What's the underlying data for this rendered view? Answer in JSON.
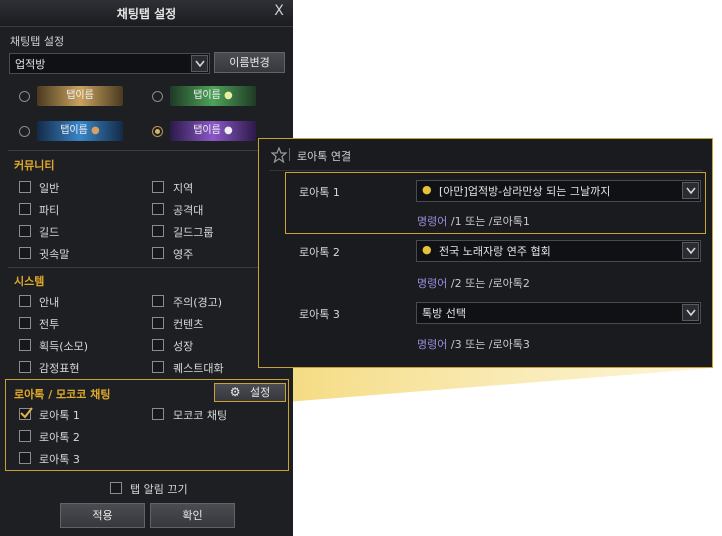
{
  "dialog": {
    "title": "채팅탭 설정",
    "close_label": "X",
    "section_label": "채팅탭 설정",
    "tab_select_value": "업적방",
    "rename_button": "이름변경",
    "tab_styles": [
      {
        "label": "탭이름",
        "selected": false
      },
      {
        "label": "탭이름",
        "selected": false
      },
      {
        "label": "탭이름",
        "selected": false
      },
      {
        "label": "탭이름",
        "selected": true
      }
    ],
    "community": {
      "title": "커뮤니티",
      "items": [
        {
          "label": "일반",
          "checked": false
        },
        {
          "label": "지역",
          "checked": false
        },
        {
          "label": "파티",
          "checked": false
        },
        {
          "label": "공격대",
          "checked": false
        },
        {
          "label": "길드",
          "checked": false
        },
        {
          "label": "길드그룹",
          "checked": false
        },
        {
          "label": "귓속말",
          "checked": false
        },
        {
          "label": "영주",
          "checked": false
        }
      ]
    },
    "system": {
      "title": "시스템",
      "items": [
        {
          "label": "안내",
          "checked": false
        },
        {
          "label": "주의(경고)",
          "checked": false
        },
        {
          "label": "전투",
          "checked": false
        },
        {
          "label": "컨텐츠",
          "checked": false
        },
        {
          "label": "획득(소모)",
          "checked": false
        },
        {
          "label": "성장",
          "checked": false
        },
        {
          "label": "감정표현",
          "checked": false
        },
        {
          "label": "퀘스트대화",
          "checked": false
        }
      ]
    },
    "lostalk": {
      "title": "로아톡 / 모코코 채팅",
      "settings_button": "설정",
      "items": [
        {
          "label": "로아톡 1",
          "checked": true
        },
        {
          "label": "모코코 채팅",
          "checked": false
        },
        {
          "label": "로아톡 2",
          "checked": false
        },
        {
          "label": "로아톡 3",
          "checked": false
        }
      ]
    },
    "mute_notify_label": "탭 알림 끄기",
    "apply_button": "적용",
    "confirm_button": "확인"
  },
  "popup": {
    "title": "로아톡 연결",
    "rows": [
      {
        "label": "로아톡 1",
        "value": "[아만]업적방-삼라만상 되는 그날까지",
        "has_icon": true,
        "cmd_key": "명령어",
        "cmd_text": " /1 또는 /로아톡1"
      },
      {
        "label": "로아톡 2",
        "value": "전국 노래자랑 연주 협회",
        "has_icon": true,
        "cmd_key": "명령어",
        "cmd_text": " /2 또는 /로아톡2"
      },
      {
        "label": "로아톡 3",
        "value": "톡방 선택",
        "has_icon": false,
        "cmd_key": "명령어",
        "cmd_text": " /3 또는 /로아톡3"
      }
    ]
  },
  "colors": {
    "accent_gold": "#c9a235",
    "section_title": "#e0a92a",
    "command_key": "#9a8bd8",
    "callout": "#f3d774"
  }
}
